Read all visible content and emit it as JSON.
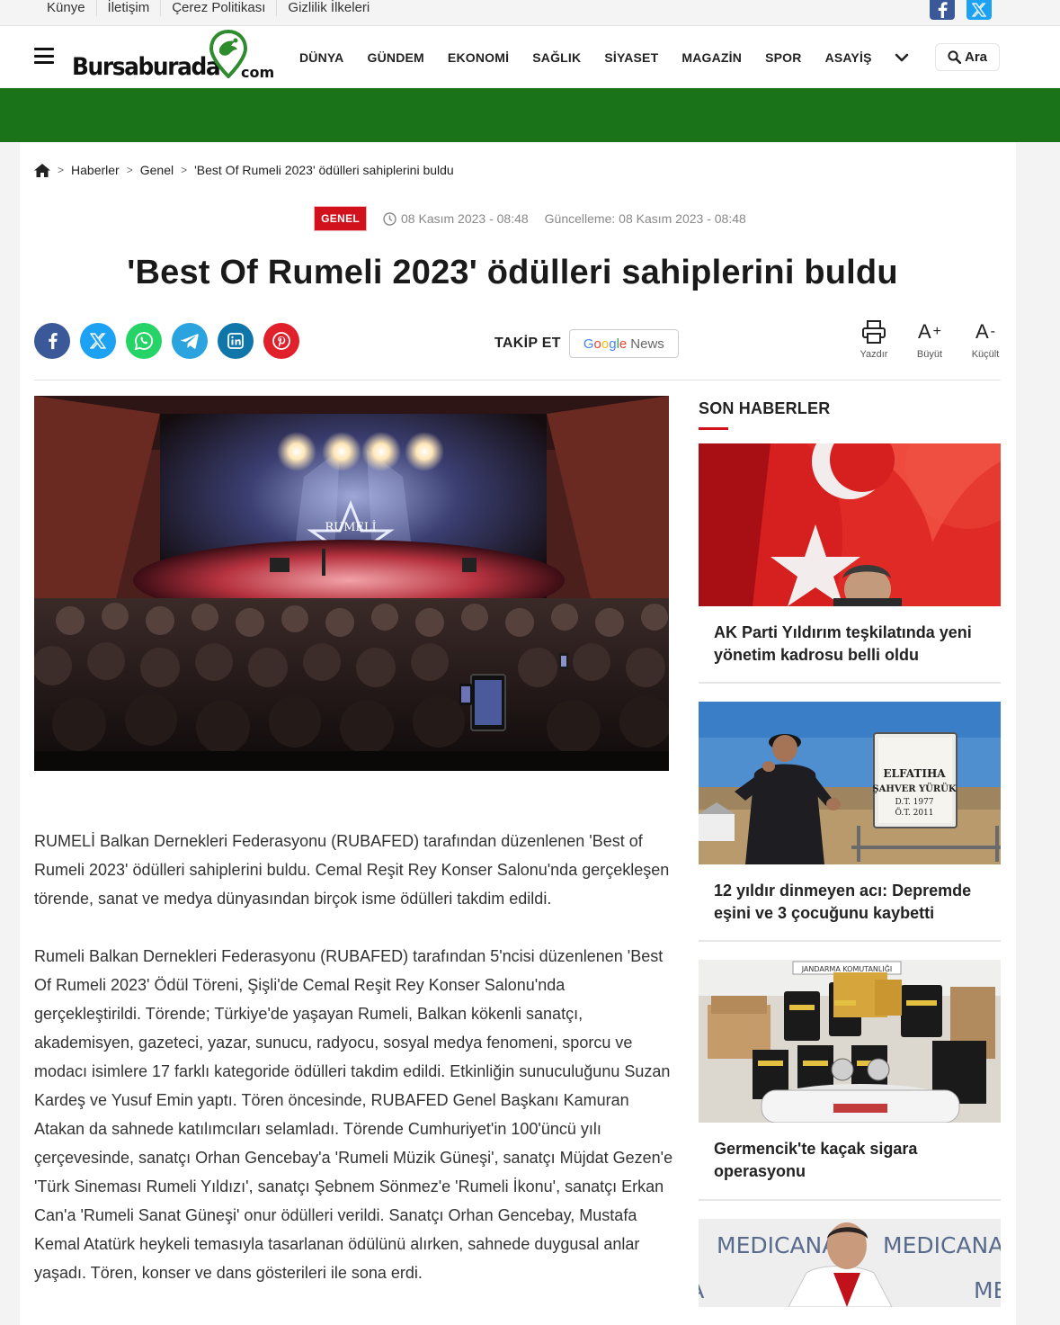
{
  "topbar": {
    "links": [
      "Künye",
      "İletişim",
      "Çerez Politikası",
      "Gizlilik İlkeleri"
    ],
    "social": [
      "facebook-icon",
      "x-icon"
    ]
  },
  "header": {
    "logo_main": "Bursaburada",
    "logo_suffix": "com",
    "nav": [
      "DÜNYA",
      "GÜNDEM",
      "EKONOMİ",
      "SAĞLIK",
      "SİYASET",
      "MAGAZİN",
      "SPOR",
      "ASAYİŞ"
    ],
    "search_label": "Ara"
  },
  "breadcrumb": {
    "items": [
      "Haberler",
      "Genel",
      "'Best Of Rumeli 2023' ödülleri sahiplerini buldu"
    ],
    "separator": ">"
  },
  "article": {
    "category": "GENEL",
    "published": "08 Kasım 2023 - 08:48",
    "updated": "Güncelleme: 08 Kasım 2023 - 08:48",
    "title": "'Best Of Rumeli 2023' ödülleri sahiplerini buldu",
    "paragraphs": [
      "RUMELİ Balkan Dernekleri Federasyonu (RUBAFED) tarafından düzenlenen 'Best of Rumeli 2023' ödülleri sahiplerini buldu. Cemal Reşit Rey Konser Salonu'nda gerçekleşen törende, sanat ve medya dünyasından birçok isme ödülleri takdim edildi.",
      "Rumeli Balkan Dernekleri Federasyonu (RUBAFED) tarafından 5'ncisi düzenlenen 'Best Of Rumeli 2023' Ödül Töreni, Şişli'de Cemal Reşit Rey Konser Salonu'nda gerçekleştirildi. Törende; Türkiye'de yaşayan Rumeli, Balkan kökenli sanatçı, akademisyen, gazeteci, yazar, sunucu, radyocu, sosyal medya fenomeni, sporcu ve modacı isimlere 17 farklı kategoride ödülleri takdim edildi. Etkinliğin sunuculuğunu Suzan Kardeş ve Yusuf Emin yaptı. Tören öncesinde, RUBAFED Genel Başkanı Kamuran Atakan da sahnede katılımcıları selamladı. Törende Cumhuriyet'in 100'üncü yılı çerçevesinde, sanatçı Orhan Gencebay'a 'Rumeli Müzik Güneşi', sanatçı Müjdat Gezen'e 'Türk Sineması Rumeli Yıldızı', sanatçı Şebnem Sönmez'e 'Rumeli İkonu', sanatçı Erkan Can'a 'Rumeli Sanat Güneşi' onur ödülleri verildi. Sanatçı Orhan Gencebay, Mustafa Kemal Atatürk heykeli temasıyla tasarlanan ödülünü alırken, sahnede duygusal anlar yaşadı. Tören, konser ve dans gösterileri ile sona erdi."
    ],
    "hero_stage_text": "RUMELİ"
  },
  "share": {
    "icons": [
      "facebook-icon",
      "x-icon",
      "whatsapp-icon",
      "telegram-icon",
      "linkedin-icon",
      "pinterest-icon"
    ],
    "follow_label": "TAKİP ET",
    "google_news": "Google",
    "google_news_suffix": "News"
  },
  "tools": [
    {
      "icon": "printer-icon",
      "label": "Yazdır"
    },
    {
      "glyph": "A",
      "sup": "+",
      "label": "Büyüt"
    },
    {
      "glyph": "A",
      "sup": "-",
      "label": "Küçült"
    }
  ],
  "sidebar": {
    "title": "SON HABERLER",
    "items": [
      {
        "caption": "AK Parti Yıldırım teşkilatında yeni yönetim kadrosu belli oldu"
      },
      {
        "caption": "12 yıldır dinmeyen acı: Depremde eşini ve 3 çocuğunu kaybetti",
        "sign_lines": [
          "ELFATIHA",
          "ŞAHVER YÜRÜK",
          "D.T. 1977",
          "Ö.T. 2011"
        ]
      },
      {
        "caption": "Germencik'te kaçak sigara operasyonu",
        "banner": "JANDARMA KOMUTANLIĞI"
      },
      {
        "ad_text": "MEDICANA"
      }
    ]
  },
  "colors": {
    "brand_green": "#1a7318",
    "accent_red": "#d1121d",
    "facebook": "#3b5998",
    "x": "#1da1f2",
    "whatsapp": "#25d366",
    "telegram": "#2aa3de",
    "linkedin": "#0e76a8",
    "pinterest": "#e0202a"
  }
}
